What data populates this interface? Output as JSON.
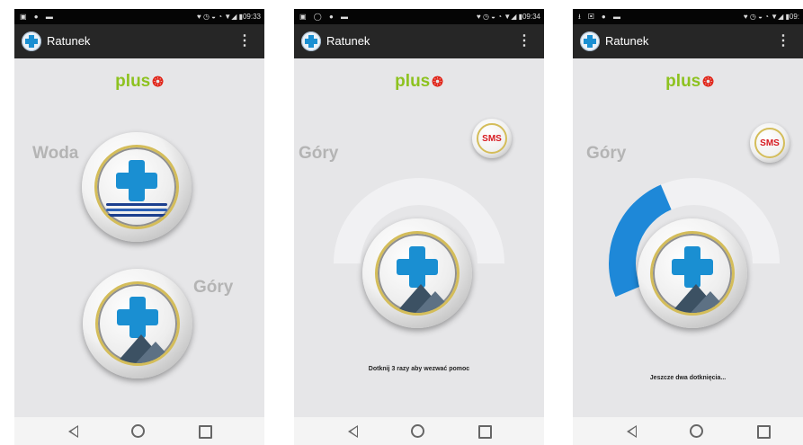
{
  "app": {
    "title": "Ratunek",
    "brand": "plus",
    "overflow_icon": "overflow-menu-icon",
    "colors": {
      "brand_green": "#8dc21f",
      "cross_blue": "#1a8fd2",
      "ring_gold": "#d4bd5a",
      "sms_red": "#d71920",
      "progress_blue": "#1e88d8"
    }
  },
  "screens": [
    {
      "status_time": "09:33",
      "labels": {
        "woda": "Woda",
        "gory": "Góry"
      },
      "buttons": [
        "water-rescue",
        "mountain-rescue"
      ]
    },
    {
      "status_time": "09:34",
      "label": "Góry",
      "sms": "SMS",
      "instruction": "Dotknij 3 razy aby wezwać pomoc",
      "tap_progress": 0
    },
    {
      "status_time": "09:",
      "label": "Góry",
      "sms": "SMS",
      "instruction": "Jeszcze dwa dotknięcia...",
      "tap_progress": 0.33
    }
  ],
  "navbar": {
    "back_icon": "back-icon",
    "home_icon": "home-icon",
    "recents_icon": "recents-icon"
  }
}
